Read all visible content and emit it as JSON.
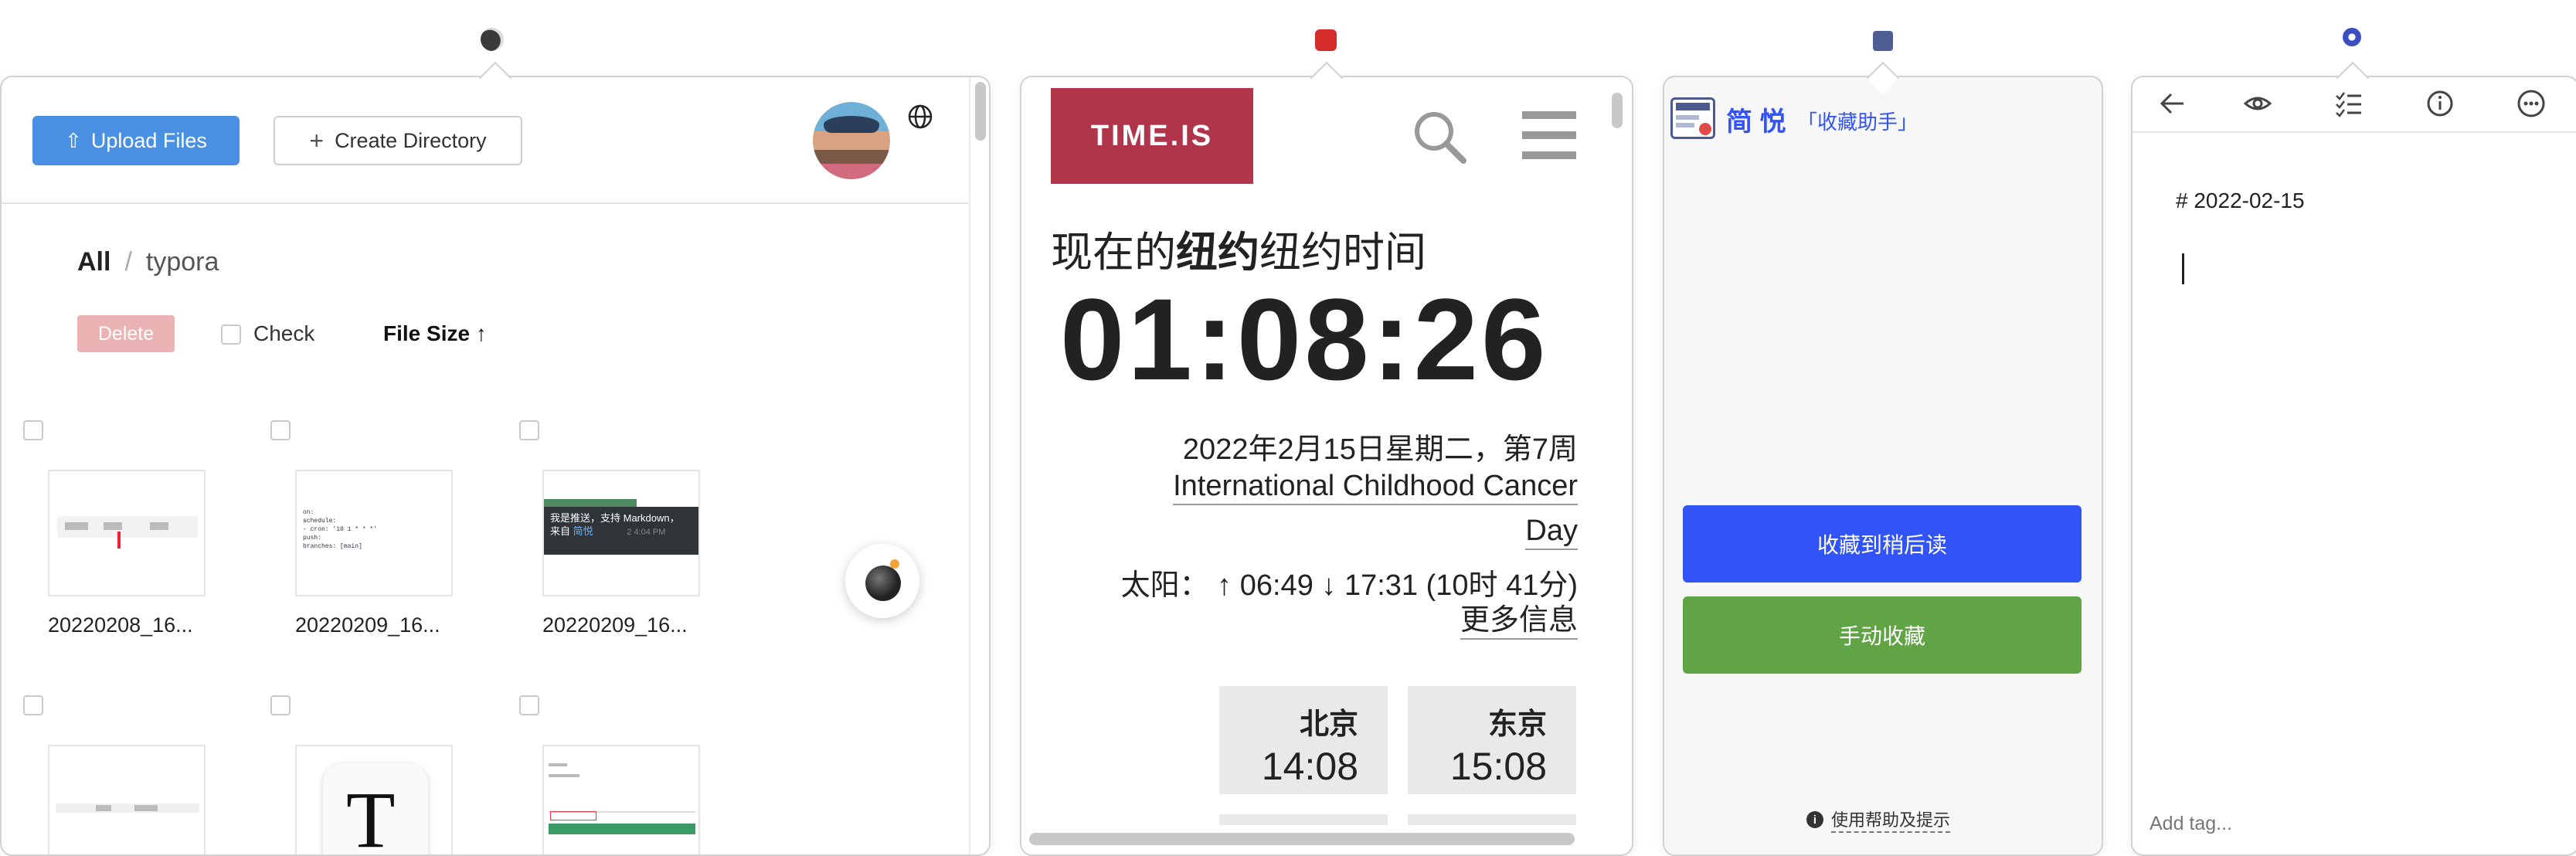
{
  "panel_files": {
    "upload_label": "Upload Files",
    "create_dir_label": "Create Directory",
    "breadcrumb": {
      "root": "All",
      "separator": "/",
      "current": "typora"
    },
    "delete_label": "Delete",
    "check_label": "Check",
    "sort_label": "File Size",
    "files": [
      {
        "name": "20220208_16..."
      },
      {
        "name": "20220209_16..."
      },
      {
        "name": "20220209_16..."
      }
    ],
    "thumb_text": {
      "markdown_line1": "我是推送，支持 Markdown，",
      "markdown_line2": "来自 ",
      "markdown_link": "简悦",
      "markdown_meta": "2  4:04 PM",
      "code_lines": [
        "on:",
        "  schedule:",
        "    - cron: '10 1 * * *'",
        "  push:",
        "    branches: [main]"
      ],
      "typora_letter": "T"
    }
  },
  "panel_time": {
    "logo": "TIME.IS",
    "heading_prefix": "现在的",
    "heading_bold": "纽约",
    "heading_suffix": "纽约时间",
    "clock": "01:08:26",
    "date": "2022年2月15日星期二，第7周",
    "event_line1": "International Childhood Cancer",
    "event_line2": "Day",
    "sun_label": "太阳：",
    "sun_times": "↑ 06:49 ↓ 17:31 (10时 41分)",
    "more_info": "更多信息",
    "cities": [
      {
        "name": "北京",
        "time": "14:08"
      },
      {
        "name": "东京",
        "time": "15:08"
      }
    ]
  },
  "panel_jianyue": {
    "title": "简 悦",
    "subtitle": "「收藏助手」",
    "read_later_label": "收藏到稍后读",
    "manual_label": "手动收藏",
    "help_label": "使用帮助及提示",
    "colors": {
      "blue": "#3253f5",
      "green": "#60a446"
    }
  },
  "panel_notes": {
    "note_text": "# 2022-02-15",
    "tag_placeholder": "Add tag..."
  }
}
